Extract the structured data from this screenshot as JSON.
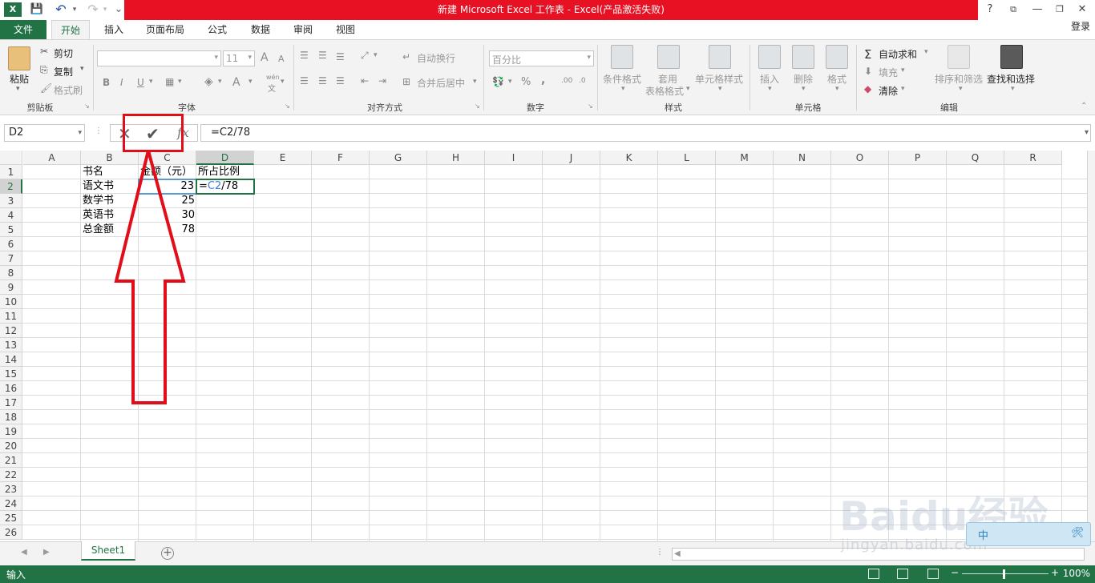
{
  "titlebar": {
    "title": "新建 Microsoft Excel 工作表 -  Excel(产品激活失败)",
    "help": "?",
    "qa_save": "💾",
    "qa_undo": "↶",
    "qa_redo": "↷",
    "qa_more": "⌄"
  },
  "tabs": {
    "file": "文件",
    "home": "开始",
    "insert": "插入",
    "layout": "页面布局",
    "formulas": "公式",
    "data": "数据",
    "review": "审阅",
    "view": "视图",
    "login": "登录"
  },
  "ribbon": {
    "clipboard": {
      "label": "剪贴板",
      "paste": "粘贴",
      "cut": "剪切",
      "copy": "复制",
      "format_painter": "格式刷"
    },
    "font": {
      "label": "字体",
      "size": "11",
      "bold": "B",
      "italic": "I",
      "underline": "U",
      "grow": "A",
      "shrink": "A",
      "fontcolor": "A",
      "wen": "wén",
      "wenzi": "文"
    },
    "alignment": {
      "label": "对齐方式",
      "wrap": "自动换行",
      "merge": "合并后居中"
    },
    "number": {
      "label": "数字",
      "format": "百分比",
      "percent": "%",
      "comma": ",",
      "inc_dec": ".00",
      "dec_dec": ".0"
    },
    "styles": {
      "label": "样式",
      "conditional": "条件格式",
      "table_1": "套用",
      "table_2": "表格格式",
      "cell_styles": "单元格样式"
    },
    "cells": {
      "label": "单元格",
      "insert": "插入",
      "delete": "删除",
      "format": "格式"
    },
    "editing": {
      "label": "编辑",
      "autosum": "自动求和",
      "fill": "填充",
      "clear": "清除",
      "sort": "排序和筛选",
      "find": "查找和选择"
    }
  },
  "formula_bar": {
    "name_box": "D2",
    "cancel": "✕",
    "enter": "✔",
    "fx": "fx",
    "formula": "=C2/78"
  },
  "grid": {
    "columns": [
      "A",
      "B",
      "C",
      "D",
      "E",
      "F",
      "G",
      "H",
      "I",
      "J",
      "K",
      "L",
      "M",
      "N",
      "O",
      "P",
      "Q",
      "R"
    ],
    "rows": [
      "1",
      "2",
      "3",
      "4",
      "5",
      "6",
      "7",
      "8",
      "9",
      "10",
      "11",
      "12",
      "13",
      "14",
      "15",
      "16",
      "17",
      "18",
      "19",
      "20",
      "21",
      "22",
      "23",
      "24",
      "25",
      "26"
    ],
    "cells": {
      "B1": "书名",
      "C1": "金额（元）",
      "D1": "所占比例",
      "B2": "语文书",
      "C2": "23",
      "D2_prefix": "=",
      "D2_ref": "C2",
      "D2_suffix": "/78",
      "B3": "数学书",
      "C3": "25",
      "B4": "英语书",
      "C4": "30",
      "B5": "总金额",
      "C5": "78"
    }
  },
  "sheet_tabs": {
    "sheet1": "Sheet1",
    "add": "+"
  },
  "status": {
    "mode": "输入",
    "zoom": "100%",
    "zoom_minus": "−",
    "zoom_plus": "+"
  },
  "watermark": {
    "brand": "Baidu经验",
    "url": "jingyan.baidu.com",
    "widget_left": "中",
    "widget_right": "🛠"
  }
}
